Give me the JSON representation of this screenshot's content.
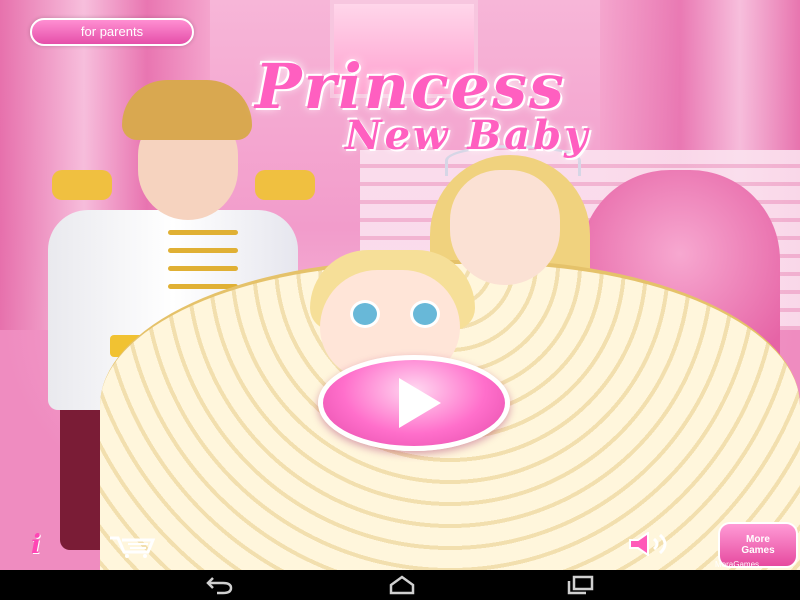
{
  "game": {
    "title_line1": "Princess",
    "title_line2": "New Baby",
    "parents_button": "for parents",
    "play_button_icon": "play-icon",
    "info_button_icon": "info-icon",
    "shop_button_icon": "cart-icon",
    "sound_button_icon": "speaker-icon",
    "more_games": {
      "label_line1": "More",
      "label_line2": "Games",
      "brand": "MoraGames"
    }
  },
  "navigation_bar": {
    "buttons": [
      "back-icon",
      "home-icon",
      "recent-apps-icon"
    ]
  },
  "colors": {
    "accent_pink": "#ff5fc0",
    "button_pink": "#e54fa9",
    "nav_bar": "#000000"
  }
}
